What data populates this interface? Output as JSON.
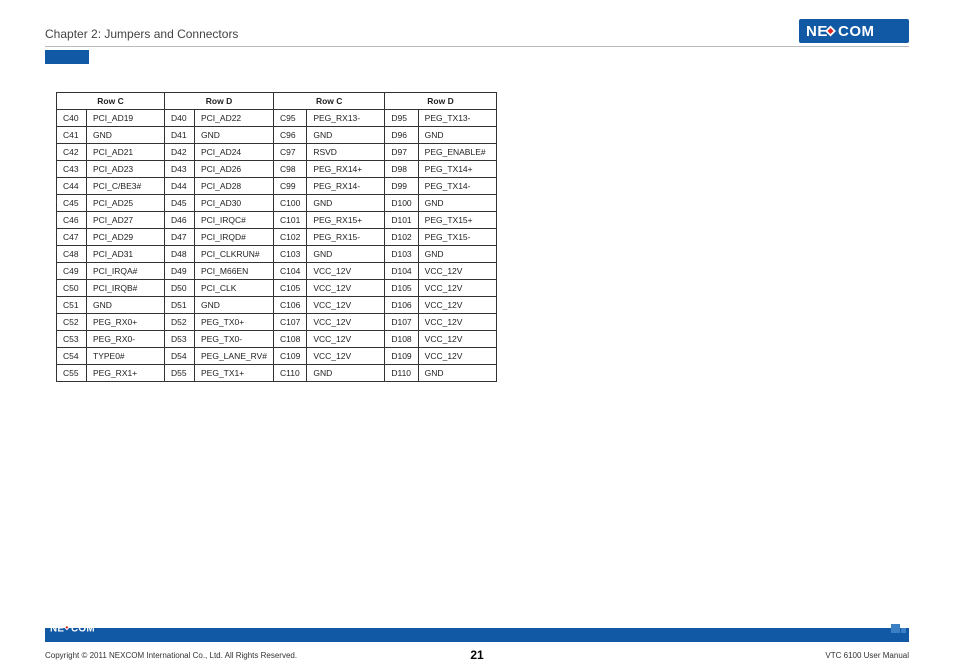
{
  "header": {
    "chapter": "Chapter 2: Jumpers and Connectors",
    "brand": "NEXCOM"
  },
  "table": {
    "headers": [
      "Row C",
      "Row D",
      "Row C",
      "Row D"
    ],
    "rows": [
      {
        "c1": "C40",
        "s1": "PCI_AD19",
        "c2": "D40",
        "s2": "PCI_AD22",
        "c3": "C95",
        "s3": "PEG_RX13-",
        "c4": "D95",
        "s4": "PEG_TX13-"
      },
      {
        "c1": "C41",
        "s1": "GND",
        "c2": "D41",
        "s2": "GND",
        "c3": "C96",
        "s3": "GND",
        "c4": "D96",
        "s4": "GND"
      },
      {
        "c1": "C42",
        "s1": "PCI_AD21",
        "c2": "D42",
        "s2": "PCI_AD24",
        "c3": "C97",
        "s3": "RSVD",
        "c4": "D97",
        "s4": "PEG_ENABLE#"
      },
      {
        "c1": "C43",
        "s1": "PCI_AD23",
        "c2": "D43",
        "s2": "PCI_AD26",
        "c3": "C98",
        "s3": "PEG_RX14+",
        "c4": "D98",
        "s4": "PEG_TX14+"
      },
      {
        "c1": "C44",
        "s1": "PCI_C/BE3#",
        "c2": "D44",
        "s2": "PCI_AD28",
        "c3": "C99",
        "s3": "PEG_RX14-",
        "c4": "D99",
        "s4": "PEG_TX14-"
      },
      {
        "c1": "C45",
        "s1": "PCI_AD25",
        "c2": "D45",
        "s2": "PCI_AD30",
        "c3": "C100",
        "s3": "GND",
        "c4": "D100",
        "s4": "GND"
      },
      {
        "c1": "C46",
        "s1": "PCI_AD27",
        "c2": "D46",
        "s2": "PCI_IRQC#",
        "c3": "C101",
        "s3": "PEG_RX15+",
        "c4": "D101",
        "s4": "PEG_TX15+"
      },
      {
        "c1": "C47",
        "s1": "PCI_AD29",
        "c2": "D47",
        "s2": "PCI_IRQD#",
        "c3": "C102",
        "s3": "PEG_RX15-",
        "c4": "D102",
        "s4": "PEG_TX15-"
      },
      {
        "c1": "C48",
        "s1": "PCI_AD31",
        "c2": "D48",
        "s2": "PCI_CLKRUN#",
        "c3": "C103",
        "s3": "GND",
        "c4": "D103",
        "s4": "GND"
      },
      {
        "c1": "C49",
        "s1": "PCI_IRQA#",
        "c2": "D49",
        "s2": "PCI_M66EN",
        "c3": "C104",
        "s3": "VCC_12V",
        "c4": "D104",
        "s4": "VCC_12V"
      },
      {
        "c1": "C50",
        "s1": "PCI_IRQB#",
        "c2": "D50",
        "s2": "PCI_CLK",
        "c3": "C105",
        "s3": "VCC_12V",
        "c4": "D105",
        "s4": "VCC_12V"
      },
      {
        "c1": "C51",
        "s1": "GND",
        "c2": "D51",
        "s2": "GND",
        "c3": "C106",
        "s3": "VCC_12V",
        "c4": "D106",
        "s4": "VCC_12V"
      },
      {
        "c1": "C52",
        "s1": "PEG_RX0+",
        "c2": "D52",
        "s2": "PEG_TX0+",
        "c3": "C107",
        "s3": "VCC_12V",
        "c4": "D107",
        "s4": "VCC_12V"
      },
      {
        "c1": "C53",
        "s1": "PEG_RX0-",
        "c2": "D53",
        "s2": "PEG_TX0-",
        "c3": "C108",
        "s3": "VCC_12V",
        "c4": "D108",
        "s4": "VCC_12V"
      },
      {
        "c1": "C54",
        "s1": "TYPE0#",
        "c2": "D54",
        "s2": "PEG_LANE_RV#",
        "c3": "C109",
        "s3": "VCC_12V",
        "c4": "D109",
        "s4": "VCC_12V"
      },
      {
        "c1": "C55",
        "s1": "PEG_RX1+",
        "c2": "D55",
        "s2": "PEG_TX1+",
        "c3": "C110",
        "s3": "GND",
        "c4": "D110",
        "s4": "GND"
      }
    ]
  },
  "footer": {
    "copyright": "Copyright © 2011 NEXCOM International Co., Ltd. All Rights Reserved.",
    "page": "21",
    "doc": "VTC 6100 User Manual"
  }
}
